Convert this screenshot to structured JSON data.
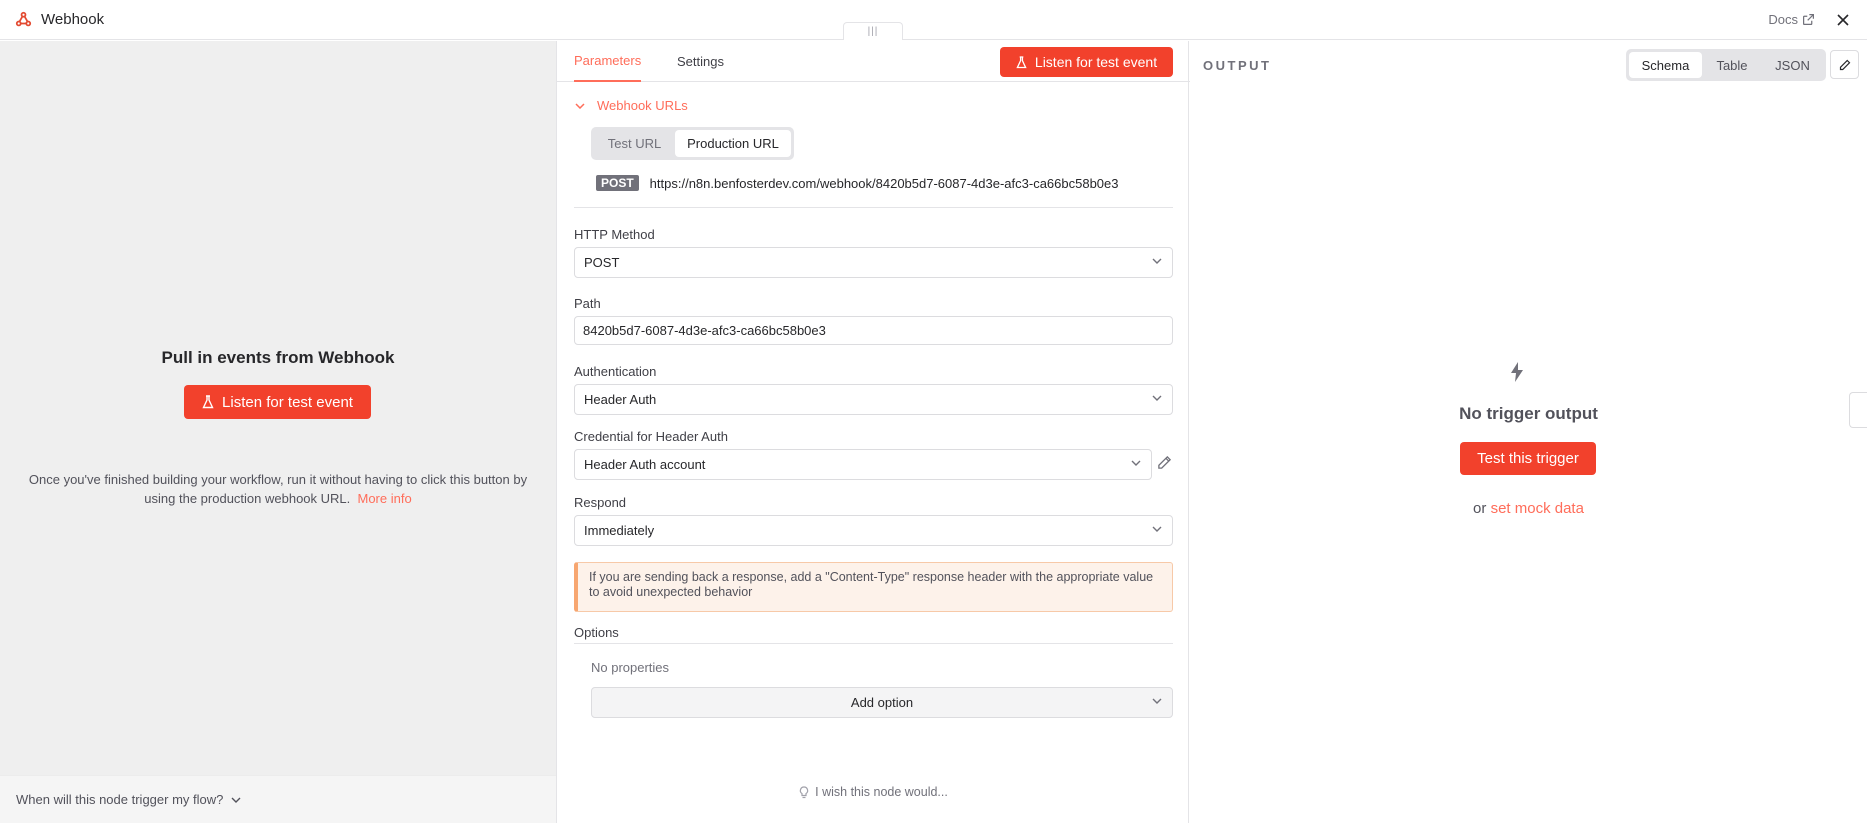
{
  "header": {
    "title": "Webhook",
    "docs_label": "Docs",
    "drag_handle": "|||"
  },
  "left": {
    "heading": "Pull in events from Webhook",
    "listen_button": "Listen for test event",
    "info_text": "Once you've finished building your workflow, run it without having to click this button by using the production webhook URL.",
    "info_link": "More info",
    "footer_text": "When will this node trigger my flow?"
  },
  "middle": {
    "tabs": [
      {
        "label": "Parameters",
        "active": true
      },
      {
        "label": "Settings",
        "active": false
      }
    ],
    "listen_button": "Listen for test event",
    "webhook_urls": {
      "section_label": "Webhook URLs",
      "options": [
        "Test URL",
        "Production URL"
      ],
      "selected": "Production URL",
      "method": "POST",
      "url": "https://n8n.benfosterdev.com/webhook/8420b5d7-6087-4d3e-afc3-ca66bc58b0e3"
    },
    "http_method": {
      "label": "HTTP Method",
      "value": "POST"
    },
    "path": {
      "label": "Path",
      "value": "8420b5d7-6087-4d3e-afc3-ca66bc58b0e3"
    },
    "authentication": {
      "label": "Authentication",
      "value": "Header Auth"
    },
    "credential": {
      "label": "Credential for Header Auth",
      "value": "Header Auth account"
    },
    "respond": {
      "label": "Respond",
      "value": "Immediately"
    },
    "notice": "If you are sending back a response, add a \"Content-Type\" response header with the appropriate value to avoid unexpected behavior",
    "options": {
      "label": "Options",
      "empty_text": "No properties",
      "add_button": "Add option"
    },
    "feedback": "I wish this node would..."
  },
  "right": {
    "output_label": "OUTPUT",
    "views": [
      "Schema",
      "Table",
      "JSON"
    ],
    "selected_view": "Schema",
    "empty_title": "No trigger output",
    "test_button": "Test this trigger",
    "mock_prefix": "or",
    "mock_link": "set mock data"
  },
  "colors": {
    "accent": "#f2412c",
    "link": "#ff6d5a",
    "notice_bg": "#fdf2ea",
    "left_bg": "#efefef"
  }
}
